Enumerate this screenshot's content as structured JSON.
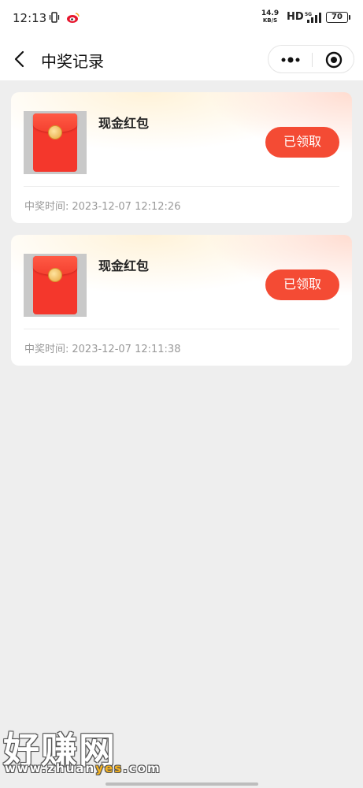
{
  "status_bar": {
    "time": "12:13",
    "icons": [
      "vibrate-icon",
      "weibo-icon"
    ],
    "net_speed_value": "14.9",
    "net_speed_unit": "KB/S",
    "hd_label": "HD",
    "network_label": "5G",
    "battery": "70"
  },
  "nav": {
    "title": "中奖记录",
    "back_icon": "chevron-left-icon",
    "menu_icon": "more-dots-icon",
    "close_icon": "target-icon"
  },
  "records": [
    {
      "title": "现金红包",
      "button_label": "已领取",
      "time_label": "中奖时间:",
      "time_value": "2023-12-07 12:12:26",
      "image": "red-envelope-icon"
    },
    {
      "title": "现金红包",
      "button_label": "已领取",
      "time_label": "中奖时间:",
      "time_value": "2023-12-07 12:11:38",
      "image": "red-envelope-icon"
    }
  ],
  "watermark": {
    "text": "好赚网",
    "url_prefix": "www.zhuan",
    "url_highlight": "yes",
    "url_suffix": ".com"
  },
  "colors": {
    "accent_button": "#f44b34",
    "page_bg": "#eeeeee",
    "muted_text": "#999999"
  }
}
